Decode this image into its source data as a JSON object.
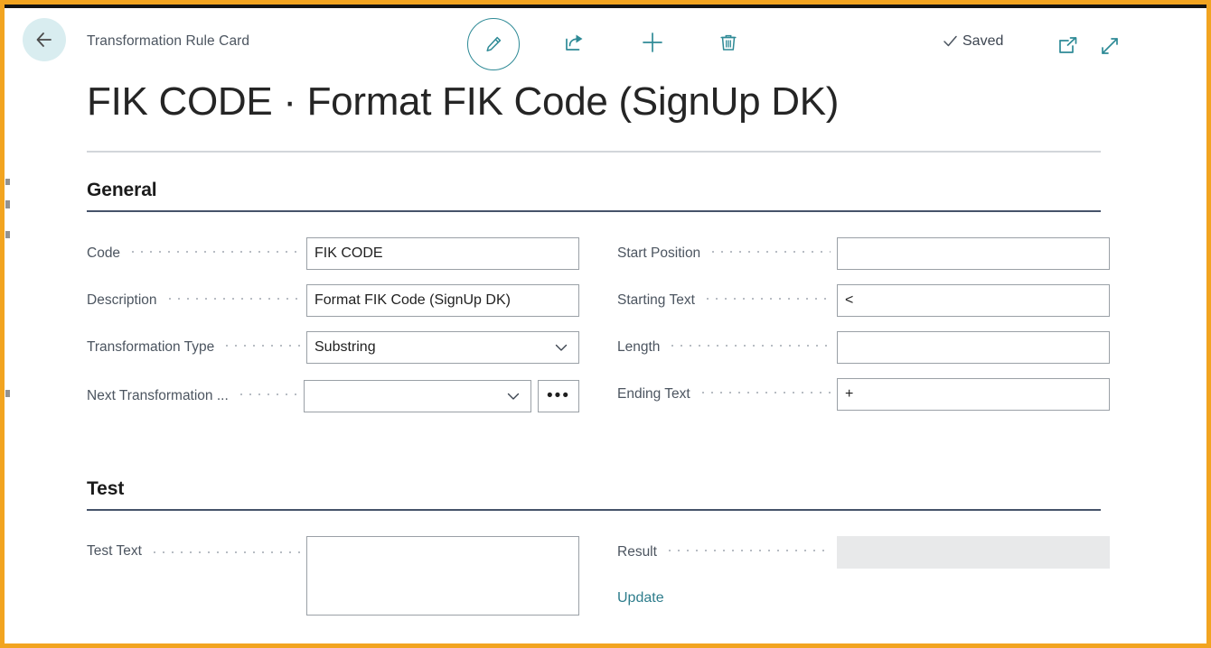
{
  "window": {
    "breadcrumb": "Transformation Rule Card",
    "page_title": "FIK CODE · Format FIK Code (SignUp DK)",
    "accent_color": "#2e8a96",
    "frame_color": "#f2a420"
  },
  "toolbar": {
    "back_label": "Back",
    "edit_label": "Edit",
    "share_label": "Share",
    "new_label": "New",
    "delete_label": "Delete",
    "saved_label": "Saved",
    "open_in_new_window_label": "Open in new window",
    "expand_label": "Expand"
  },
  "sections": [
    {
      "id": "general",
      "heading": "General"
    },
    {
      "id": "test",
      "heading": "Test"
    }
  ],
  "general": {
    "left": [
      {
        "label": "Code",
        "value": "FIK CODE",
        "type": "text",
        "placeholder": ""
      },
      {
        "label": "Description",
        "value": "Format FIK Code (SignUp DK)",
        "type": "text",
        "placeholder": ""
      },
      {
        "label": "Transformation Type",
        "value": "Substring",
        "type": "dropdown",
        "placeholder": ""
      },
      {
        "label": "Next Transformation ...",
        "value": "",
        "type": "dropdown-lookup",
        "placeholder": "",
        "lookup_label": "•••"
      }
    ],
    "right": [
      {
        "label": "Start Position",
        "value": "",
        "type": "text",
        "placeholder": ""
      },
      {
        "label": "Starting Text",
        "value": "<",
        "type": "text",
        "placeholder": ""
      },
      {
        "label": "Length",
        "value": "",
        "type": "text",
        "placeholder": ""
      },
      {
        "label": "Ending Text",
        "value": "+",
        "type": "text",
        "placeholder": ""
      }
    ]
  },
  "test": {
    "test_text": {
      "label": "Test Text",
      "value": "",
      "placeholder": ""
    },
    "result": {
      "label": "Result",
      "value": "",
      "readonly": true
    },
    "update_link": "Update"
  }
}
